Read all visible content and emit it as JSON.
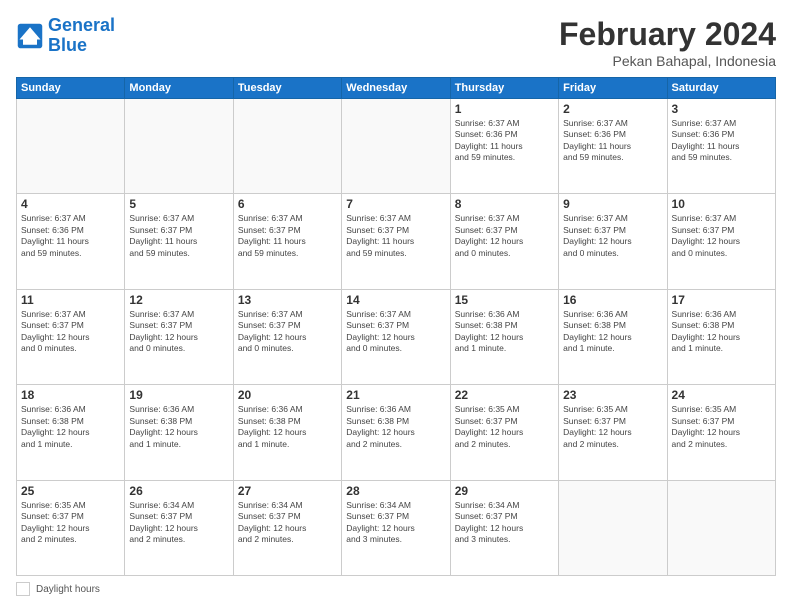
{
  "header": {
    "logo_line1": "General",
    "logo_line2": "Blue",
    "month": "February 2024",
    "location": "Pekan Bahapal, Indonesia"
  },
  "days_of_week": [
    "Sunday",
    "Monday",
    "Tuesday",
    "Wednesday",
    "Thursday",
    "Friday",
    "Saturday"
  ],
  "weeks": [
    [
      {
        "day": "",
        "info": ""
      },
      {
        "day": "",
        "info": ""
      },
      {
        "day": "",
        "info": ""
      },
      {
        "day": "",
        "info": ""
      },
      {
        "day": "1",
        "info": "Sunrise: 6:37 AM\nSunset: 6:36 PM\nDaylight: 11 hours\nand 59 minutes."
      },
      {
        "day": "2",
        "info": "Sunrise: 6:37 AM\nSunset: 6:36 PM\nDaylight: 11 hours\nand 59 minutes."
      },
      {
        "day": "3",
        "info": "Sunrise: 6:37 AM\nSunset: 6:36 PM\nDaylight: 11 hours\nand 59 minutes."
      }
    ],
    [
      {
        "day": "4",
        "info": "Sunrise: 6:37 AM\nSunset: 6:36 PM\nDaylight: 11 hours\nand 59 minutes."
      },
      {
        "day": "5",
        "info": "Sunrise: 6:37 AM\nSunset: 6:37 PM\nDaylight: 11 hours\nand 59 minutes."
      },
      {
        "day": "6",
        "info": "Sunrise: 6:37 AM\nSunset: 6:37 PM\nDaylight: 11 hours\nand 59 minutes."
      },
      {
        "day": "7",
        "info": "Sunrise: 6:37 AM\nSunset: 6:37 PM\nDaylight: 11 hours\nand 59 minutes."
      },
      {
        "day": "8",
        "info": "Sunrise: 6:37 AM\nSunset: 6:37 PM\nDaylight: 12 hours\nand 0 minutes."
      },
      {
        "day": "9",
        "info": "Sunrise: 6:37 AM\nSunset: 6:37 PM\nDaylight: 12 hours\nand 0 minutes."
      },
      {
        "day": "10",
        "info": "Sunrise: 6:37 AM\nSunset: 6:37 PM\nDaylight: 12 hours\nand 0 minutes."
      }
    ],
    [
      {
        "day": "11",
        "info": "Sunrise: 6:37 AM\nSunset: 6:37 PM\nDaylight: 12 hours\nand 0 minutes."
      },
      {
        "day": "12",
        "info": "Sunrise: 6:37 AM\nSunset: 6:37 PM\nDaylight: 12 hours\nand 0 minutes."
      },
      {
        "day": "13",
        "info": "Sunrise: 6:37 AM\nSunset: 6:37 PM\nDaylight: 12 hours\nand 0 minutes."
      },
      {
        "day": "14",
        "info": "Sunrise: 6:37 AM\nSunset: 6:37 PM\nDaylight: 12 hours\nand 0 minutes."
      },
      {
        "day": "15",
        "info": "Sunrise: 6:36 AM\nSunset: 6:38 PM\nDaylight: 12 hours\nand 1 minute."
      },
      {
        "day": "16",
        "info": "Sunrise: 6:36 AM\nSunset: 6:38 PM\nDaylight: 12 hours\nand 1 minute."
      },
      {
        "day": "17",
        "info": "Sunrise: 6:36 AM\nSunset: 6:38 PM\nDaylight: 12 hours\nand 1 minute."
      }
    ],
    [
      {
        "day": "18",
        "info": "Sunrise: 6:36 AM\nSunset: 6:38 PM\nDaylight: 12 hours\nand 1 minute."
      },
      {
        "day": "19",
        "info": "Sunrise: 6:36 AM\nSunset: 6:38 PM\nDaylight: 12 hours\nand 1 minute."
      },
      {
        "day": "20",
        "info": "Sunrise: 6:36 AM\nSunset: 6:38 PM\nDaylight: 12 hours\nand 1 minute."
      },
      {
        "day": "21",
        "info": "Sunrise: 6:36 AM\nSunset: 6:38 PM\nDaylight: 12 hours\nand 2 minutes."
      },
      {
        "day": "22",
        "info": "Sunrise: 6:35 AM\nSunset: 6:37 PM\nDaylight: 12 hours\nand 2 minutes."
      },
      {
        "day": "23",
        "info": "Sunrise: 6:35 AM\nSunset: 6:37 PM\nDaylight: 12 hours\nand 2 minutes."
      },
      {
        "day": "24",
        "info": "Sunrise: 6:35 AM\nSunset: 6:37 PM\nDaylight: 12 hours\nand 2 minutes."
      }
    ],
    [
      {
        "day": "25",
        "info": "Sunrise: 6:35 AM\nSunset: 6:37 PM\nDaylight: 12 hours\nand 2 minutes."
      },
      {
        "day": "26",
        "info": "Sunrise: 6:34 AM\nSunset: 6:37 PM\nDaylight: 12 hours\nand 2 minutes."
      },
      {
        "day": "27",
        "info": "Sunrise: 6:34 AM\nSunset: 6:37 PM\nDaylight: 12 hours\nand 2 minutes."
      },
      {
        "day": "28",
        "info": "Sunrise: 6:34 AM\nSunset: 6:37 PM\nDaylight: 12 hours\nand 3 minutes."
      },
      {
        "day": "29",
        "info": "Sunrise: 6:34 AM\nSunset: 6:37 PM\nDaylight: 12 hours\nand 3 minutes."
      },
      {
        "day": "",
        "info": ""
      },
      {
        "day": "",
        "info": ""
      }
    ]
  ],
  "footer": {
    "daylight_label": "Daylight hours"
  }
}
